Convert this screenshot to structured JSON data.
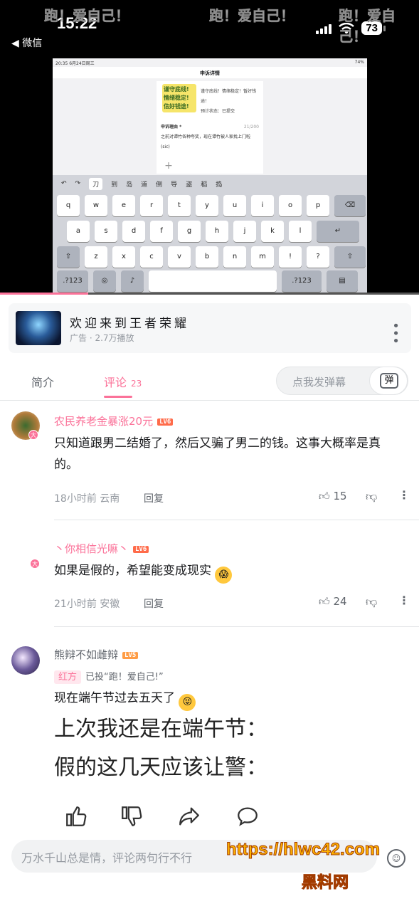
{
  "status_bar": {
    "time": "15:22",
    "back_label": "◀ 微信",
    "battery": "73"
  },
  "video": {
    "watermark": "跑！爱自己！",
    "inner_status": "20:35  6月24日周三",
    "inner_battery": "74%",
    "inner_title": "申诉详情",
    "sticker_lines": [
      "谨守底线!",
      "情绪稳定!",
      "信好钱途!"
    ],
    "card1_text": [
      "谨守底线！情绪稳定！暂好钱途！",
      "",
      "预计状态：已提交"
    ],
    "card2_label": "申诉理由 *",
    "card2_text": "之前对谭竹各种夸奖，现在谭竹被人家找上门啦(sic)",
    "card2_count": "21/200",
    "keyboard_toolbar": [
      "↶",
      "↷",
      "刀",
      "到",
      "岛",
      "道",
      "倒",
      "导",
      "盗",
      "稻",
      "捣"
    ],
    "row1": [
      "q",
      "w",
      "e",
      "r",
      "t",
      "y",
      "u",
      "i",
      "o",
      "p",
      "⌫"
    ],
    "row2": [
      "a",
      "s",
      "d",
      "f",
      "g",
      "h",
      "j",
      "k",
      "l",
      "↵"
    ],
    "row3": [
      "⇧",
      "z",
      "x",
      "c",
      "v",
      "b",
      "n",
      "m",
      "!",
      "?",
      "⇧"
    ],
    "row4_left": ".?123",
    "row4_right": ".?123"
  },
  "playback": {
    "progress": 0.21
  },
  "ad": {
    "title": "欢迎来到王者荣耀",
    "subtitle": "广告 · 2.7万播放"
  },
  "tabs": {
    "intro": "简介",
    "comments": "评论",
    "comment_count": "23",
    "danmaku_placeholder": "点我发弹幕",
    "danmaku_icon": "弹"
  },
  "comments": [
    {
      "user": "农民养老金暴涨20元",
      "level": "LV6",
      "text": "只知道跟男二结婚了，然后又骗了男二的钱。这事大概率是真的。",
      "meta": "18小时前 云南",
      "reply": "回复",
      "likes": "15"
    },
    {
      "user": "丶你相信光嘛丶",
      "level": "LV6",
      "text": "如果是假的，希望能变成现实",
      "meta": "21小时前 安徽",
      "reply": "回复",
      "likes": "24"
    },
    {
      "user": "熊辩不如雌辩",
      "level": "LV5",
      "faction_tag": "红方",
      "faction_text": "已投“跑！爱自己!”",
      "text": "现在端午节过去五天了",
      "image_lines": [
        "上次我还是在端午节：",
        "假的这几天应该让警："
      ]
    }
  ],
  "badge_label": "大",
  "input": {
    "placeholder": "万水千山总是情，评论两句行不行"
  },
  "watermark_url": "https://hlwc42.com",
  "watermark_name": "黑料网",
  "colors": {
    "accent": "#fb7299",
    "text": "#18191c",
    "muted": "#9499a0"
  }
}
